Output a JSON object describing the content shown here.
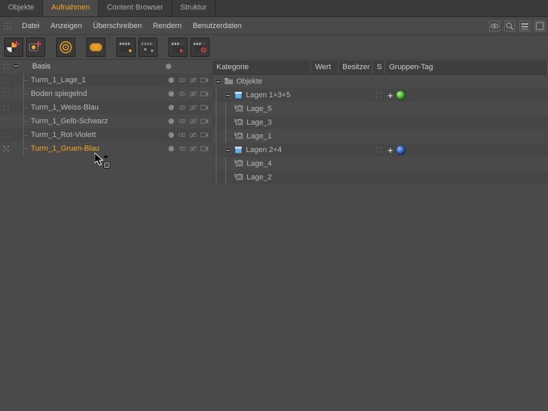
{
  "tabs": [
    "Objekte",
    "Aufnahmen",
    "Content Browser",
    "Struktur"
  ],
  "active_tab": 1,
  "menu": [
    "Datei",
    "Anzeigen",
    "Überschreiben",
    "Rendern",
    "Benutzerdaten"
  ],
  "tree": {
    "root": "Basis",
    "items": [
      "Turm_1_Lage_1",
      "Boden spiegelnd",
      "Turm_1_Weiss-Blau",
      "Turm_1_Gelb-Schwarz",
      "Turm_1_Rot-Violett",
      "Turm_1_Gruen-Blau"
    ],
    "selected_index": 5
  },
  "table": {
    "headers": {
      "kat": "Kategorie",
      "wert": "Wert",
      "bes": "Besitzer",
      "s": "S",
      "grp": "Gruppen-Tag"
    },
    "root": "Objekte",
    "groups": [
      {
        "label": "Lagen 1+3+5",
        "sphere": "green",
        "children": [
          "Lage_5",
          "Lage_3",
          "Lage_1"
        ]
      },
      {
        "label": "Lagen 2+4",
        "sphere": "blue",
        "children": [
          "Lage_4",
          "Lage_2"
        ]
      }
    ]
  }
}
